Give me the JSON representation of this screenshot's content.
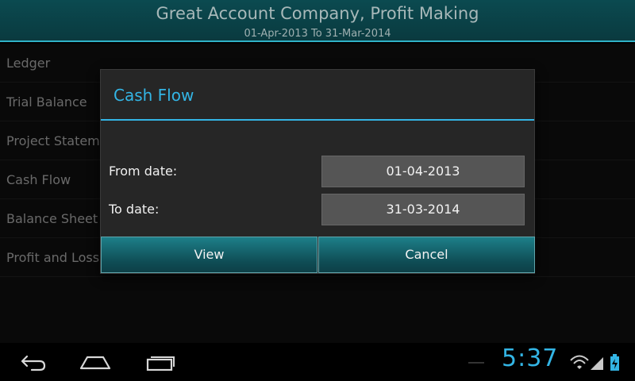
{
  "header": {
    "title": "Great Account Company, Profit Making",
    "subtitle": "01-Apr-2013 To 31-Mar-2014"
  },
  "reports": [
    {
      "label": "Ledger"
    },
    {
      "label": "Trial Balance"
    },
    {
      "label": "Project Statement"
    },
    {
      "label": "Cash Flow"
    },
    {
      "label": "Balance Sheet"
    },
    {
      "label": "Profit and Loss"
    }
  ],
  "dialog": {
    "title": "Cash Flow",
    "from_label": "From date:",
    "from_value": "01-04-2013",
    "to_label": "To date:",
    "to_value": "31-03-2014",
    "view_button": "View",
    "cancel_button": "Cancel"
  },
  "statusbar": {
    "time": "5:37",
    "icons": [
      "back-icon",
      "home-icon",
      "recent-apps-icon",
      "wifi-icon",
      "signal-icon",
      "battery-charging-icon"
    ]
  },
  "colors": {
    "accent": "#33b5e5",
    "header_bg": "#0b4a50",
    "button_bg": "#1d7f89"
  }
}
